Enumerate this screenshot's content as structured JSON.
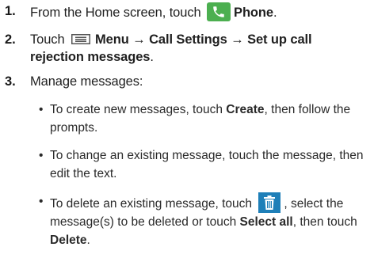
{
  "steps": [
    {
      "number": "1.",
      "text_before": "From the Home screen, touch",
      "bold": "Phone",
      "text_after": ".",
      "icon": "phone-icon"
    },
    {
      "number": "2.",
      "text_before": "Touch",
      "bold_path": "Menu → Call Settings → Set up call rejection messages",
      "text_after": ".",
      "icon": "menu-icon"
    },
    {
      "number": "3.",
      "text": "Manage messages:"
    }
  ],
  "bullets": [
    {
      "dot": "•",
      "text_before": "To create new messages, touch",
      "bold": "Create",
      "text_after": ", then follow the prompts."
    },
    {
      "dot": "•",
      "text": "To change an existing message, touch the message, then edit the text."
    },
    {
      "dot": "•",
      "text_before": "To delete an existing message, touch",
      "icon": "trash-icon",
      "text_middle": ", select the message(s) to be deleted or touch",
      "bold_select": "Select all",
      "text_then": ", then touch",
      "bold_delete": "Delete",
      "text_after": "."
    }
  ],
  "colors": {
    "phone_icon_bg": "#4caf50",
    "trash_icon_bg": "#1e7fb8",
    "text": "#1f1f1f"
  }
}
